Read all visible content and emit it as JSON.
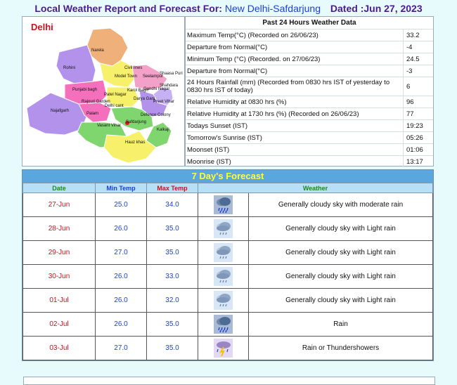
{
  "header": {
    "prefix": "Local Weather Report and Forecast For:",
    "station": "New Delhi-Safdarjung",
    "dated": "Dated :Jun 27, 2023"
  },
  "map": {
    "title": "Delhi",
    "districts": [
      "Narela",
      "Rohini",
      "Civil lines",
      "Seelampur",
      "Model Town",
      "Shahdara",
      "Shaasa Puri",
      "Punjabi bagh",
      "Patel Nagar",
      "Karol Bagh",
      "Preet Vihar",
      "Rajouri Garden",
      "Delhi cant",
      "Darya Ganj",
      "Gandhi Nagar",
      "Najafgarh",
      "Palam",
      "Vasant Vihar",
      "Defence Colony",
      "Safdarjung",
      "Kalkaji",
      "Hauz khas"
    ],
    "marker_label": "Safdarjung"
  },
  "past24": {
    "heading": "Past 24 Hours Weather Data",
    "rows": [
      {
        "label": "Maximum Temp(°C) (Recorded on 26/06/23)",
        "value": "33.2"
      },
      {
        "label": "Departure from Normal(°C)",
        "value": "-4"
      },
      {
        "label": "Minimum Temp (°C) (Recorded. on 27/06/23)",
        "value": "24.5"
      },
      {
        "label": "Departure from Normal(°C)",
        "value": "-3"
      },
      {
        "label": "24 Hours Rainfall (mm) (Recorded from 0830 hrs IST of yesterday to 0830 hrs IST of today)",
        "value": "6"
      },
      {
        "label": "Relative Humidity at 0830 hrs (%)",
        "value": "96"
      },
      {
        "label": "Relative Humidity at 1730 hrs (%) (Recorded on 26/06/23)",
        "value": "77"
      },
      {
        "label": "Todays Sunset (IST)",
        "value": "19:23"
      },
      {
        "label": "Tomorrow's Sunrise (IST)",
        "value": "05:26"
      },
      {
        "label": "Moonset (IST)",
        "value": "01:06"
      },
      {
        "label": "Moonrise (IST)",
        "value": "13:17"
      }
    ]
  },
  "forecast": {
    "heading": "7 Day's Forecast",
    "columns": {
      "date": "Date",
      "min": "Min Temp",
      "max": "Max Temp",
      "weather": "Weather"
    },
    "days": [
      {
        "date": "27-Jun",
        "min": "25.0",
        "max": "34.0",
        "icon": "rain-cloud-icon",
        "weather": "Generally cloudy sky with moderate rain"
      },
      {
        "date": "28-Jun",
        "min": "26.0",
        "max": "35.0",
        "icon": "light-rain-cloud-icon",
        "weather": "Generally cloudy sky with Light rain"
      },
      {
        "date": "29-Jun",
        "min": "27.0",
        "max": "35.0",
        "icon": "light-rain-cloud-icon",
        "weather": "Generally cloudy sky with Light rain"
      },
      {
        "date": "30-Jun",
        "min": "26.0",
        "max": "33.0",
        "icon": "light-rain-cloud-icon",
        "weather": "Generally cloudy sky with Light rain"
      },
      {
        "date": "01-Jul",
        "min": "26.0",
        "max": "32.0",
        "icon": "light-rain-cloud-icon",
        "weather": "Generally cloudy sky with Light rain"
      },
      {
        "date": "02-Jul",
        "min": "26.0",
        "max": "35.0",
        "icon": "rain-cloud-icon",
        "weather": "Rain"
      },
      {
        "date": "03-Jul",
        "min": "27.0",
        "max": "35.0",
        "icon": "thunderstorm-icon",
        "weather": "Rain or Thundershowers"
      }
    ]
  }
}
